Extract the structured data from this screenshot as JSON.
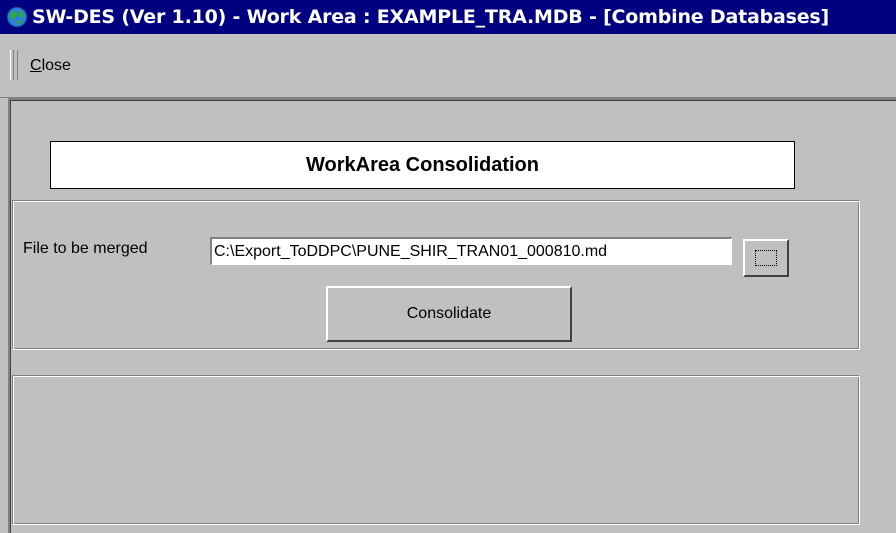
{
  "window": {
    "title": "SW-DES (Ver 1.10) - Work Area : EXAMPLE_TRA.MDB - [Combine Databases]"
  },
  "toolbar": {
    "close_mnemonic": "C",
    "close_rest": "lose"
  },
  "form": {
    "heading": "WorkArea Consolidation",
    "file_label": "File to be merged",
    "file_value": "C:\\Export_ToDDPC\\PUNE_SHIR_TRAN01_000810.md",
    "consolidate_label": "Consolidate"
  },
  "icons": {
    "app": "globe-icon",
    "browse": "ellipsis-browse-icon"
  },
  "colors": {
    "titlebar": "#000080",
    "face": "#c0c0c0",
    "field": "#ffffff"
  }
}
